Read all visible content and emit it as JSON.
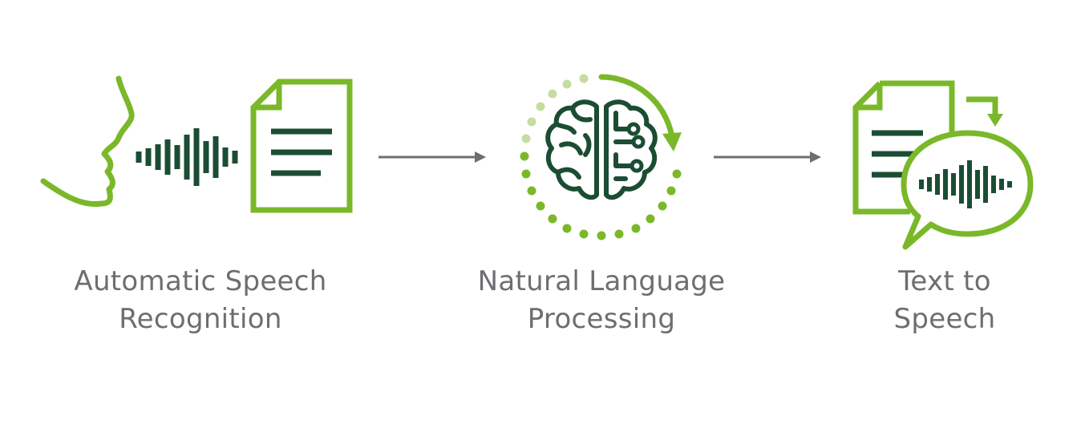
{
  "colors": {
    "accent_green": "#7ab829",
    "light_green": "#c5dda0",
    "dark_green": "#1b4d33",
    "arrow_gray": "#6d6e71",
    "label_gray": "#6d6e71"
  },
  "stages": [
    {
      "icon": "speech-to-document-icon",
      "label_line1": "Automatic Speech",
      "label_line2": "Recognition"
    },
    {
      "icon": "brain-circuit-icon",
      "label_line1": "Natural Language",
      "label_line2": "Processing"
    },
    {
      "icon": "document-to-speech-bubble-icon",
      "label_line1": "Text to",
      "label_line2": "Speech"
    }
  ],
  "connectors": [
    {
      "from": "Automatic Speech Recognition",
      "to": "Natural Language Processing"
    },
    {
      "from": "Natural Language Processing",
      "to": "Text to Speech"
    }
  ]
}
